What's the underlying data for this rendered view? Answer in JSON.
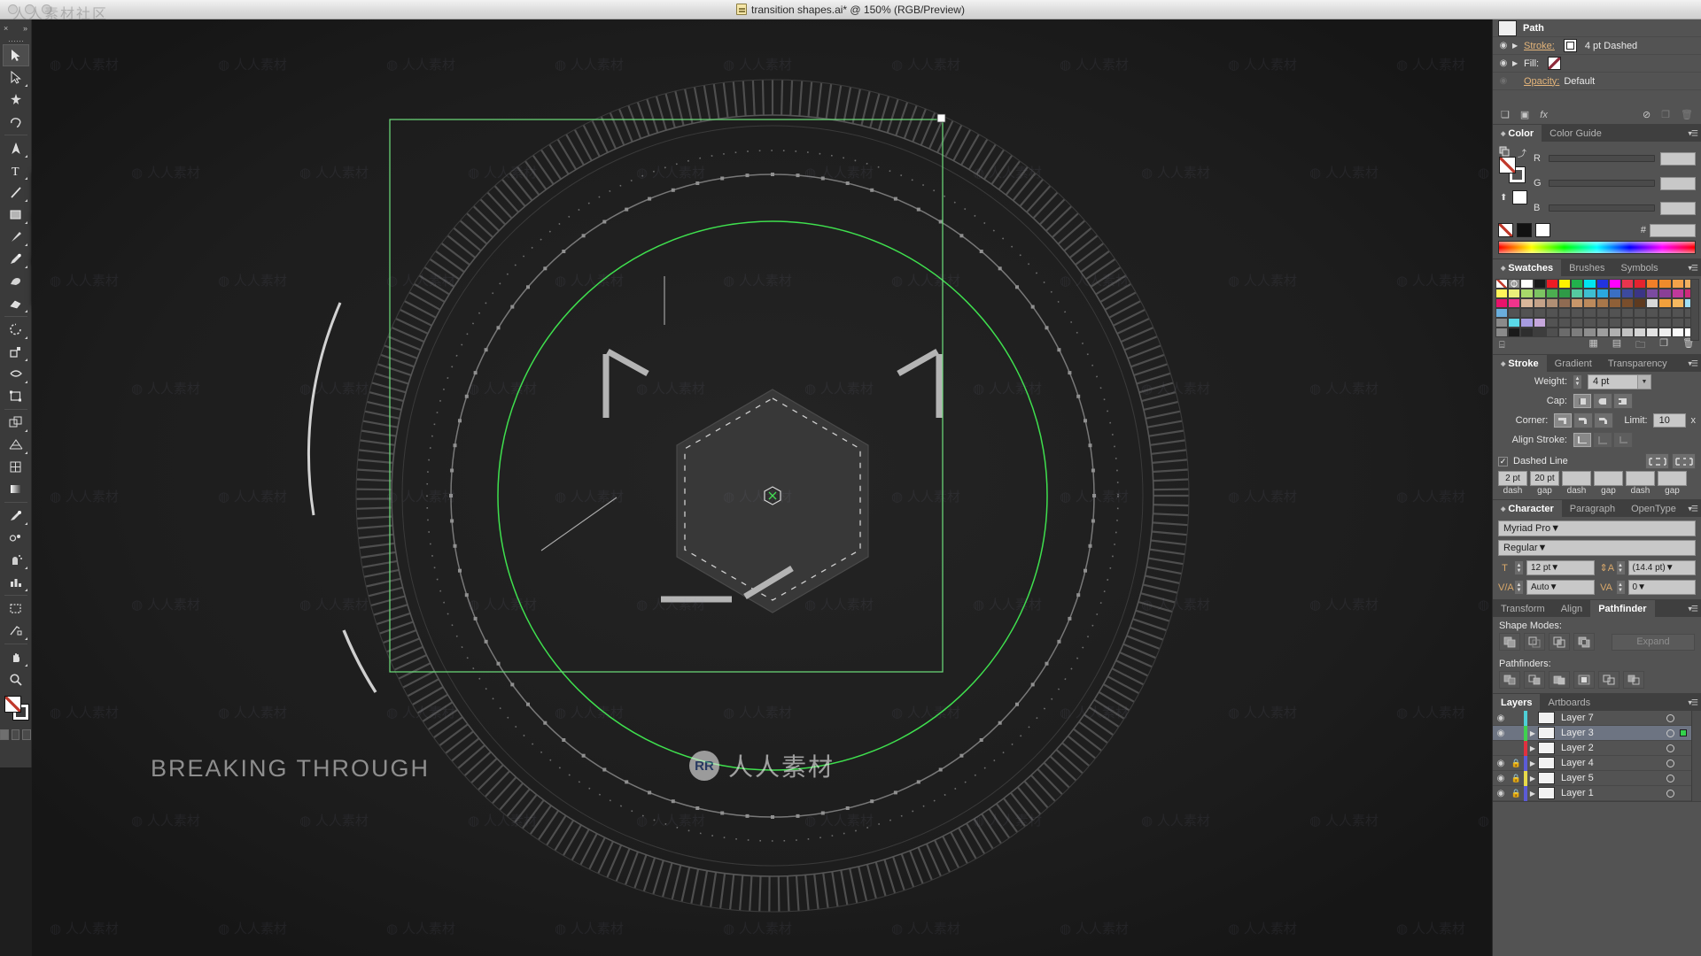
{
  "titlebar": {
    "document_title": "transition shapes.ai* @ 150% (RGB/Preview)",
    "ghost_watermark": "人人素材社区"
  },
  "toolbar": {
    "close_label": "×",
    "collapse_label": "»",
    "tools": [
      {
        "name": "selection-tool",
        "active": true,
        "more": false
      },
      {
        "name": "direct-selection-tool",
        "active": false,
        "more": true
      },
      {
        "name": "magic-wand-tool",
        "active": false,
        "more": false
      },
      {
        "name": "lasso-tool",
        "active": false,
        "more": false
      },
      {
        "name": "pen-tool",
        "active": false,
        "more": true
      },
      {
        "name": "type-tool",
        "active": false,
        "more": true
      },
      {
        "name": "line-segment-tool",
        "active": false,
        "more": true
      },
      {
        "name": "rectangle-tool",
        "active": false,
        "more": true
      },
      {
        "name": "paintbrush-tool",
        "active": false,
        "more": true
      },
      {
        "name": "pencil-tool",
        "active": false,
        "more": true
      },
      {
        "name": "blob-brush-tool",
        "active": false,
        "more": false
      },
      {
        "name": "eraser-tool",
        "active": false,
        "more": true
      },
      {
        "name": "rotate-tool",
        "active": false,
        "more": true
      },
      {
        "name": "scale-tool",
        "active": false,
        "more": true
      },
      {
        "name": "width-tool",
        "active": false,
        "more": true
      },
      {
        "name": "free-transform-tool",
        "active": false,
        "more": false
      },
      {
        "name": "shape-builder-tool",
        "active": false,
        "more": true
      },
      {
        "name": "perspective-grid-tool",
        "active": false,
        "more": true
      },
      {
        "name": "mesh-tool",
        "active": false,
        "more": false
      },
      {
        "name": "gradient-tool",
        "active": false,
        "more": false
      },
      {
        "name": "eyedropper-tool",
        "active": false,
        "more": true
      },
      {
        "name": "blend-tool",
        "active": false,
        "more": false
      },
      {
        "name": "symbol-sprayer-tool",
        "active": false,
        "more": true
      },
      {
        "name": "column-graph-tool",
        "active": false,
        "more": true
      },
      {
        "name": "artboard-tool",
        "active": false,
        "more": false
      },
      {
        "name": "slice-tool",
        "active": false,
        "more": true
      },
      {
        "name": "hand-tool",
        "active": false,
        "more": true
      },
      {
        "name": "zoom-tool",
        "active": false,
        "more": false
      }
    ]
  },
  "float_panels": [
    {
      "name": "shapes-tearoff",
      "tools": [
        "rectangle-tool",
        "rounded-rectangle-tool",
        "ellipse-tool",
        "polygon-tool",
        "star-tool",
        "flare-tool"
      ]
    },
    {
      "name": "pen-tearoff",
      "tools": [
        "pen-tool",
        "add-anchor-point-tool",
        "delete-anchor-point-tool",
        "anchor-point-tool"
      ]
    },
    {
      "name": "rotate-tearoff",
      "tools": [
        "rotate-tool",
        "reflect-tool"
      ]
    },
    {
      "name": "shapebuilder-tearoff",
      "tools": [
        "shape-builder-tool",
        "live-paint-bucket-tool",
        "live-paint-selection-tool"
      ]
    }
  ],
  "canvas": {
    "artwork_title": "BREAKING THROUGH",
    "watermark_logo": "RR",
    "watermark_text": "人人素材",
    "tile_watermark": "人人素材"
  },
  "appearance": {
    "panel_title": "Path",
    "rows": [
      {
        "label": "Stroke:",
        "value": "4 pt Dashed",
        "visible": true,
        "expandable": true,
        "underline": true
      },
      {
        "label": "Fill:",
        "value": "",
        "visible": true,
        "expandable": true,
        "underline": false
      },
      {
        "label": "Opacity:",
        "value": "Default",
        "visible": false,
        "expandable": false,
        "underline": true
      }
    ],
    "footer_icons": [
      "add-new-stroke-icon",
      "add-new-fill-icon",
      "add-effect-icon",
      "clear-appearance-icon",
      "duplicate-item-icon",
      "delete-item-icon"
    ]
  },
  "color_panel": {
    "tabs": [
      {
        "label": "Color",
        "active": true
      },
      {
        "label": "Color Guide",
        "active": false
      }
    ],
    "sliders": [
      {
        "label": "R",
        "value": ""
      },
      {
        "label": "G",
        "value": ""
      },
      {
        "label": "B",
        "value": ""
      }
    ],
    "hex_label": "#",
    "hex_value": ""
  },
  "swatches_panel": {
    "tabs": [
      {
        "label": "Swatches",
        "active": true
      },
      {
        "label": "Brushes",
        "active": false
      },
      {
        "label": "Symbols",
        "active": false
      }
    ],
    "rows": [
      [
        "#ffffff",
        "#9a9a9a",
        "#ffffff",
        "#1a1a1a",
        "#ed1c24",
        "#fff200",
        "#22b14c",
        "#00e5f0",
        "#2233e0",
        "#ff00ff",
        "#e8354e",
        "#e5232e",
        "#f07f28",
        "#ef8b2c",
        "#f4a24a",
        "#f0b060"
      ],
      [
        "#fff45a",
        "#e9f07a",
        "#a8d86a",
        "#7cc462",
        "#4cae50",
        "#2f9a47",
        "#55c9a0",
        "#3ebfd0",
        "#2aa8e0",
        "#3a6fc4",
        "#3d4a9e",
        "#3b3585",
        "#7b4ba0",
        "#8a3f96",
        "#c0399b",
        "#cf2a7a"
      ],
      [
        "#e8136b",
        "#f0348c",
        "#d9b79a",
        "#c4a288",
        "#b08f74",
        "#8f6b52",
        "#c8976a",
        "#bc8a5c",
        "#a8774a",
        "#8f6038",
        "#7a4e2c",
        "#5e3a1f",
        "#d8d8d8",
        "#f2a03c",
        "#f5b860",
        "#9fdff5"
      ],
      [
        "#6aaedc",
        "#535353",
        "#535353",
        "#535353",
        "#535353",
        "#535353",
        "#535353",
        "#535353",
        "#535353",
        "#535353",
        "#535353",
        "#535353",
        "#535353",
        "#535353",
        "#535353",
        "#535353"
      ],
      [
        "#8a8a8a",
        "#5ad8e8",
        "#a79ce0",
        "#c6a7dc",
        "#535353",
        "#535353",
        "#535353",
        "#535353",
        "#535353",
        "#535353",
        "#535353",
        "#535353",
        "#535353",
        "#535353",
        "#535353",
        "#535353"
      ],
      [
        "#8a8a8a",
        "#1a1a1a",
        "#2e2e2e",
        "#3d3d3d",
        "#4f4f4f",
        "#6b6b6b",
        "#7d7d7d",
        "#8e8e8e",
        "#9e9e9e",
        "#b0b0b0",
        "#c2c2c2",
        "#d4d4d4",
        "#e2e2e2",
        "#efefef",
        "#fafafa",
        "#ffffff"
      ]
    ],
    "footer_icons": [
      "swatch-libraries-icon",
      "show-swatch-kinds-icon",
      "swatch-options-icon",
      "new-color-group-icon",
      "new-swatch-icon",
      "delete-swatch-icon"
    ]
  },
  "stroke_panel": {
    "tabs": [
      {
        "label": "Stroke",
        "active": true
      },
      {
        "label": "Gradient",
        "active": false
      },
      {
        "label": "Transparency",
        "active": false
      }
    ],
    "weight_label": "Weight:",
    "weight_value": "4 pt",
    "cap_label": "Cap:",
    "cap_options": [
      "butt-cap-icon",
      "round-cap-icon",
      "projecting-cap-icon"
    ],
    "cap_selected": 0,
    "corner_label": "Corner:",
    "corner_options": [
      "miter-join-icon",
      "round-join-icon",
      "bevel-join-icon"
    ],
    "corner_selected": 0,
    "limit_label": "Limit:",
    "limit_value": "10",
    "limit_unit": "x",
    "align_label": "Align Stroke:",
    "align_options": [
      "align-center-icon",
      "align-inside-icon",
      "align-outside-icon"
    ],
    "align_selected": 0,
    "dashed_label": "Dashed Line",
    "dashed_checked": true,
    "dash_cap_options": [
      "preserve-dash-exact-icon",
      "align-dashes-corners-icon"
    ],
    "dash_values": [
      "2 pt",
      "20 pt",
      "",
      "",
      "",
      ""
    ],
    "dash_labels": [
      "dash",
      "gap",
      "dash",
      "gap",
      "dash",
      "gap"
    ]
  },
  "character_panel": {
    "tabs": [
      {
        "label": "Character",
        "active": true
      },
      {
        "label": "Paragraph",
        "active": false
      },
      {
        "label": "OpenType",
        "active": false
      }
    ],
    "font_family": "Myriad Pro",
    "font_style": "Regular",
    "font_size": "12 pt",
    "leading": "(14.4 pt)",
    "kerning": "Auto",
    "tracking": "0"
  },
  "pathfinder_panel": {
    "tabs": [
      {
        "label": "Transform",
        "active": false
      },
      {
        "label": "Align",
        "active": false
      },
      {
        "label": "Pathfinder",
        "active": true
      }
    ],
    "shape_modes_label": "Shape Modes:",
    "shape_modes": [
      "unite-icon",
      "minus-front-icon",
      "intersect-icon",
      "exclude-icon"
    ],
    "expand_label": "Expand",
    "pathfinders_label": "Pathfinders:",
    "pathfinders": [
      "divide-icon",
      "trim-icon",
      "merge-icon",
      "crop-icon",
      "outline-icon",
      "minus-back-icon"
    ]
  },
  "layers_panel": {
    "tabs": [
      {
        "label": "Layers",
        "active": true
      },
      {
        "label": "Artboards",
        "active": false
      }
    ],
    "rows": [
      {
        "name": "Layer 7",
        "visible": true,
        "locked": false,
        "expandable": false,
        "color": "#4ecfd6",
        "selected": false,
        "targeted": false
      },
      {
        "name": "Layer 3",
        "visible": true,
        "locked": false,
        "expandable": true,
        "color": "#3fd14f",
        "selected": true,
        "targeted": true
      },
      {
        "name": "Layer 2",
        "visible": false,
        "locked": false,
        "expandable": true,
        "color": "#e0313f",
        "selected": false,
        "targeted": false
      },
      {
        "name": "Layer 4",
        "visible": true,
        "locked": true,
        "expandable": true,
        "color": "#5b5bd6",
        "selected": false,
        "targeted": false
      },
      {
        "name": "Layer 5",
        "visible": true,
        "locked": true,
        "expandable": true,
        "color": "#e8d94a",
        "selected": false,
        "targeted": false
      },
      {
        "name": "Layer 1",
        "visible": true,
        "locked": true,
        "expandable": true,
        "color": "#5b5bd6",
        "selected": false,
        "targeted": false
      }
    ]
  }
}
